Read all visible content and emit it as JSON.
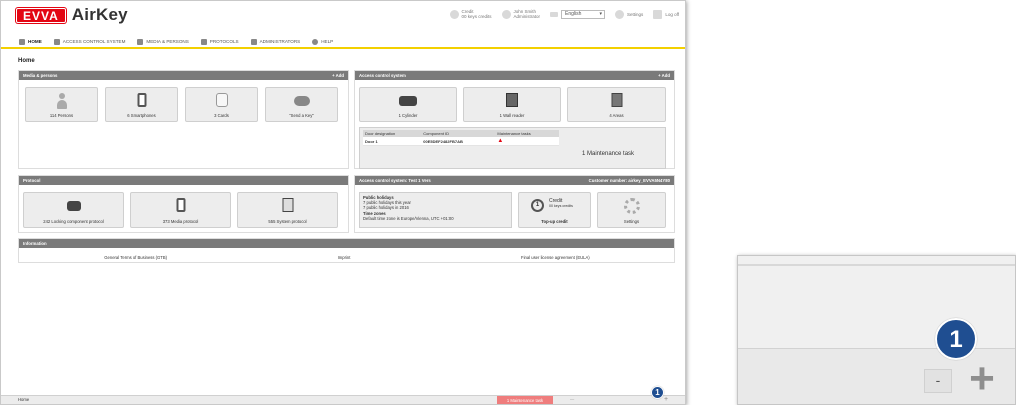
{
  "app": {
    "brand_box": "EVVA",
    "brand_name": "AirKey"
  },
  "topbar": {
    "credit_label": "Credit",
    "credit_value": "00 keys credits",
    "user_name": "John Smith",
    "user_role": "Administrator",
    "language": "English",
    "settings_label": "Settings",
    "logoff_label": "Log off"
  },
  "nav": [
    {
      "label": "Home",
      "active": true
    },
    {
      "label": "Access control system"
    },
    {
      "label": "Media & Persons"
    },
    {
      "label": "Protocols"
    },
    {
      "label": "Administrators"
    },
    {
      "label": "Help"
    }
  ],
  "page_title": "Home",
  "media_persons": {
    "title": "Media & persons",
    "add": "+ Add",
    "tiles": [
      "114 Persons",
      "6 Smartphones",
      "3 Cards",
      "\"Send a Key\""
    ]
  },
  "access_control": {
    "title": "Access control system",
    "add": "+ Add",
    "tiles": [
      "1 Cylinder",
      "1 Wall reader",
      "4 Areas"
    ],
    "table_headers": [
      "Door designation",
      "Component ID",
      "Maintenance tasks"
    ],
    "table_rows": [
      [
        "Door 1",
        "00E5DEF2482FB7AB",
        ""
      ]
    ],
    "maintenance_text": "1 Maintenance task"
  },
  "protocol": {
    "title": "Protocol",
    "tiles": [
      "242 Locking component protocol",
      "373 Media protocol",
      "555 System protocol"
    ]
  },
  "access_test": {
    "title": "Access control system: Test 1 Vers",
    "customer": "Customer number: airkey_EVVA5N4Y80",
    "holidays_title": "Public holidays",
    "holidays_line1": "7 public holidays this year",
    "holidays_line2": "7 public holidays in 2016",
    "timezones_title": "Time zones",
    "timezones_line": "Default time zone is Europe/Vienna, UTC +01:00",
    "credit_tile_label": "Top-up credit",
    "credit_tile_title": "Credit",
    "credit_tile_sub": "00 keys credits",
    "credit_tile_num": "1",
    "settings_tile": "Settings"
  },
  "information": {
    "title": "Information",
    "links": [
      "General Terms of Business (GTB)",
      "Imprint",
      "Final user license agreement (EULA)"
    ]
  },
  "statusbar": {
    "home": "Home",
    "maintenance": "1 Maintenance task",
    "dash": "—",
    "plus": "+",
    "badge": "1"
  },
  "zoom": {
    "badge": "1",
    "minus": "-",
    "plus": "+"
  },
  "colors": {
    "brand_red": "#e30613",
    "nav_accent": "#f3d000",
    "panel_header": "#7a7a7a",
    "badge_blue": "#1f4e91",
    "maintenance_red": "#ef7d7d"
  }
}
